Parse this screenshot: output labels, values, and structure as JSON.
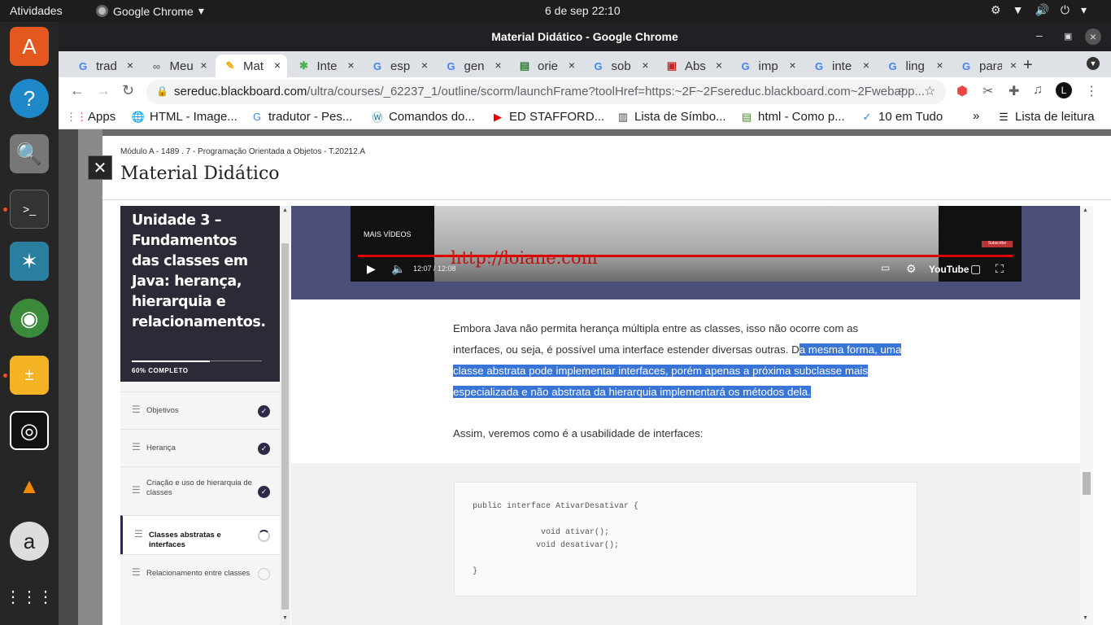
{
  "topbar": {
    "activities": "Atividades",
    "app_name": "Google Chrome",
    "clock": "6 de sep  22:10"
  },
  "window": {
    "title": "Material Didático - Google Chrome"
  },
  "tabs": [
    {
      "title": "trad",
      "icon": "google-icon"
    },
    {
      "title": "Meu",
      "icon": "link-icon"
    },
    {
      "title": "Mat",
      "icon": "edit-icon",
      "active": true
    },
    {
      "title": "Inte",
      "icon": "refresh-icon"
    },
    {
      "title": "esp",
      "icon": "google-icon"
    },
    {
      "title": "gen",
      "icon": "google-icon"
    },
    {
      "title": "orie",
      "icon": "file-icon"
    },
    {
      "title": "sob",
      "icon": "google-icon"
    },
    {
      "title": "Abs",
      "icon": "abs-icon"
    },
    {
      "title": "imp",
      "icon": "google-icon"
    },
    {
      "title": "inte",
      "icon": "google-icon"
    },
    {
      "title": "ling",
      "icon": "google-icon"
    },
    {
      "title": "para",
      "icon": "google-icon"
    }
  ],
  "omnibox": {
    "domain": "sereduc.blackboard.com",
    "path": "/ultra/courses/_62237_1/outline/scorm/launchFrame?toolHref=https:~2F~2Fsereduc.blackboard.com~2Fwebapp..."
  },
  "bookmarks": {
    "items": [
      {
        "label": "Apps",
        "icon": "apps-grid-icon"
      },
      {
        "label": "HTML - Image...",
        "icon": "globe-icon"
      },
      {
        "label": "tradutor - Pes...",
        "icon": "google-icon"
      },
      {
        "label": "Comandos do...",
        "icon": "wordpress-icon"
      },
      {
        "label": "ED STAFFORD...",
        "icon": "youtube-icon"
      },
      {
        "label": "Lista de Símbo...",
        "icon": "doc-icon"
      },
      {
        "label": "html - Como p...",
        "icon": "stackexchange-icon"
      },
      {
        "label": "10 em Tudo",
        "icon": "check-icon"
      }
    ],
    "overflow": "»",
    "reading_list": "Lista de leitura"
  },
  "panel": {
    "breadcrumb": "Módulo A - 1489 . 7 - Programação Orientada a Objetos - T.20212.A",
    "title": "Material Didático"
  },
  "unit": {
    "title": "Unidade 3 – Fundamentos das classes em Java: herança, hierarquia e relacionamentos.",
    "progress_label": "60% COMPLETO",
    "progress": 0.6,
    "lessons": [
      {
        "label": "Objetivos",
        "status": "done"
      },
      {
        "label": "Herança",
        "status": "done"
      },
      {
        "label": "Criação e uso de hierarquia de classes",
        "status": "done"
      },
      {
        "label": "Classes abstratas e interfaces",
        "status": "current"
      },
      {
        "label": "Relacionamento entre classes",
        "status": "todo"
      }
    ]
  },
  "video": {
    "more_videos": "MAIS VÍDEOS",
    "watermark": "http://loiane.com",
    "time": "12:07 / 12:08",
    "subscribe": "Subscribe",
    "youtube": "YouTube",
    "played_fraction": 0.998
  },
  "article": {
    "p1_plain": "Embora Java não permita herança múltipla entre as classes, isso não ocorre com as interfaces, ou seja, é possível uma interface estender diversas outras. D",
    "p1_selected": "a mesma forma, uma classe abstrata pode implementar interfaces, porém apenas a próxima subclasse mais especializada e não abstrata da hierarquia implementará os métodos dela.",
    "p2": "Assim, veremos como é a usabilidade de interfaces:"
  },
  "code": "public interface AtivarDesativar {\n\n              void ativar();\n             void desativar();\n\n}"
}
